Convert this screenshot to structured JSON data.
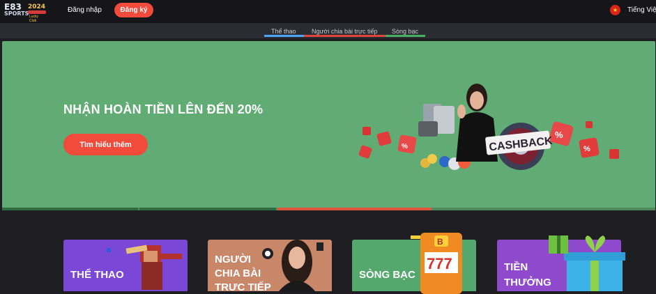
{
  "header": {
    "logo": {
      "line1": "E83",
      "line2": "SPORTS",
      "year": "2024",
      "tagline": "Lucky Club"
    },
    "login_label": "Đăng nhập",
    "signup_label": "Đăng ký",
    "language": "Tiếng Việt",
    "language_flag": "vietnam-flag-icon"
  },
  "tabs": [
    {
      "label": "Thể thao",
      "color": "#4fa4f2"
    },
    {
      "label": "Người chia bài trực tiếp",
      "color": "#e0453b"
    },
    {
      "label": "Sòng bạc",
      "color": "#48b05f"
    }
  ],
  "banner": {
    "headline": "NHẬN HOÀN TIỀN LÊN ĐẾN 20%",
    "cta_label": "Tìm hiểu thêm",
    "badge_text": "CASHBACK",
    "bg_color": "#61ab74",
    "slides": 3,
    "active_slide": 3
  },
  "categories": [
    {
      "label": "THỂ THAO",
      "color": "#7b47d6"
    },
    {
      "label": "NGƯỜI CHIA BÀI TRỰC TIẾP",
      "lines": [
        "NGƯỜI",
        "CHIA BÀI",
        "TRỰC TIẾP"
      ],
      "color": "#c9876a"
    },
    {
      "label": "SÒNG BẠC",
      "color": "#54a76d"
    },
    {
      "label": "TIỀN THƯỞNG",
      "lines": [
        "TIỀN",
        "THƯỞNG"
      ],
      "color": "#8f49cc"
    }
  ]
}
